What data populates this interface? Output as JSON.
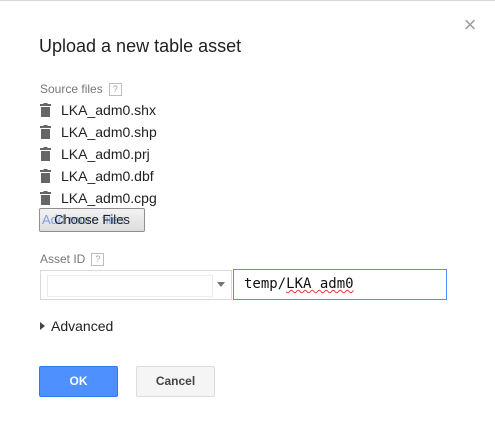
{
  "dialog": {
    "title": "Upload a new table asset",
    "close_icon": "×"
  },
  "source_files": {
    "label": "Source files",
    "help": "?",
    "files": [
      {
        "name": "LKA_adm0.shx"
      },
      {
        "name": "LKA_adm0.shp"
      },
      {
        "name": "LKA_adm0.prj"
      },
      {
        "name": "LKA_adm0.dbf"
      },
      {
        "name": "LKA_adm0.cpg"
      }
    ],
    "choose_button": "Choose Files",
    "add_more_text": "Add more files"
  },
  "asset_id": {
    "label": "Asset ID",
    "help": "?",
    "folder_select_value": "",
    "path_prefix": "temp/",
    "path_name": "LKA adm0"
  },
  "advanced": {
    "label": "Advanced"
  },
  "buttons": {
    "ok": "OK",
    "cancel": "Cancel"
  },
  "colors": {
    "primary": "#4d90fe",
    "focus_border": "#4d90fe",
    "spellcheck": "#e53935"
  }
}
